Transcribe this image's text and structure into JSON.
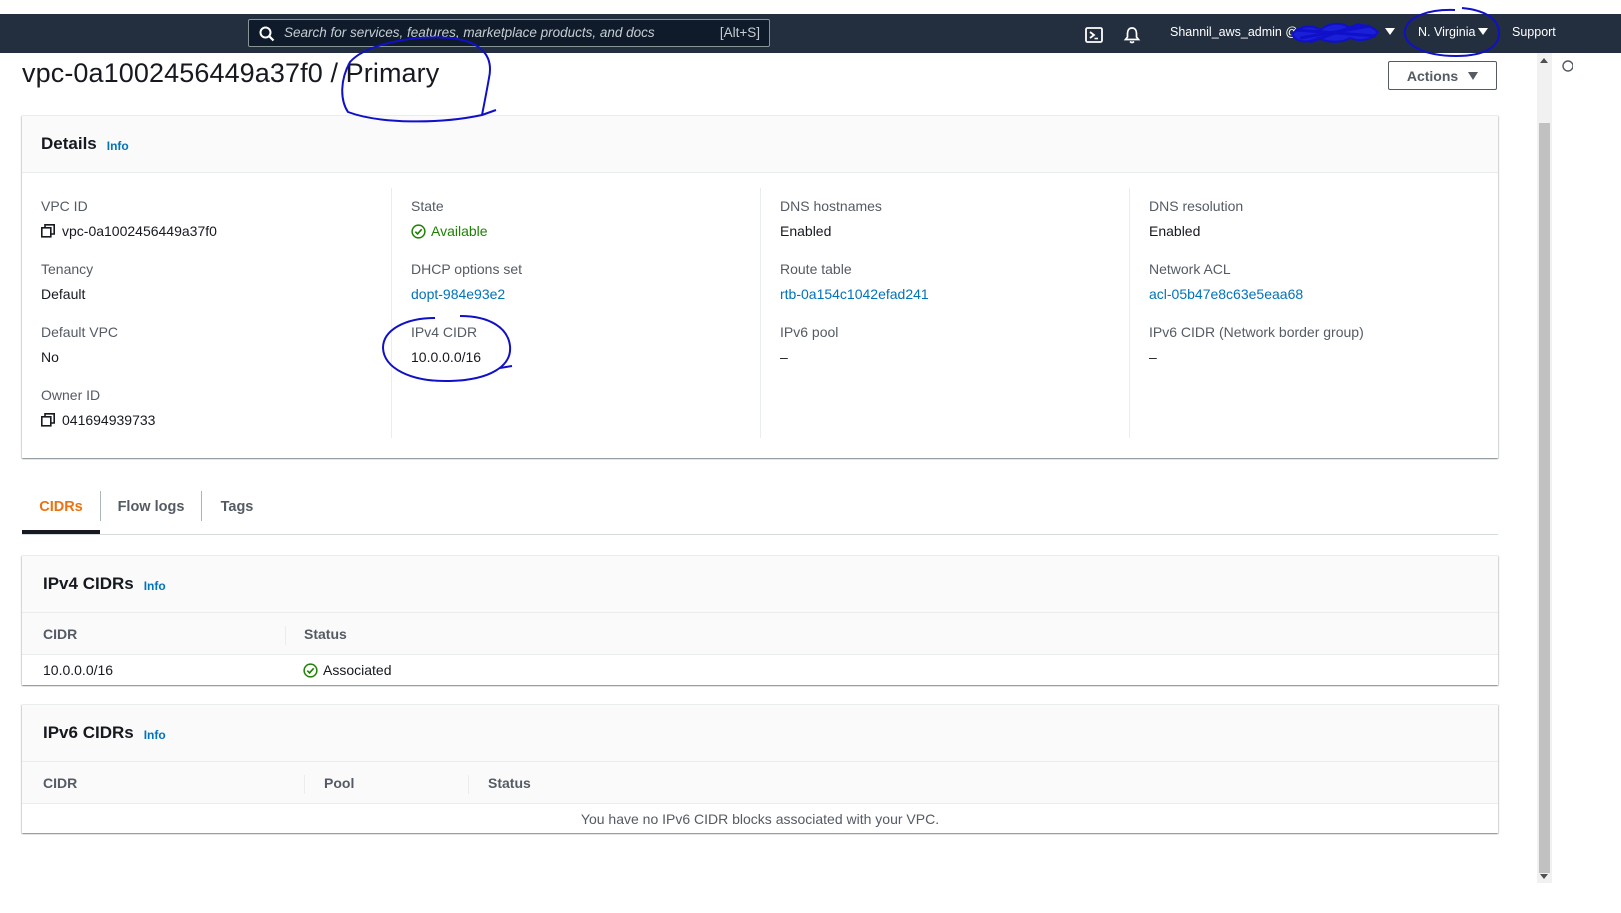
{
  "nav": {
    "search_placeholder": "Search for services, features, marketplace products, and docs",
    "search_shortcut": "[Alt+S]",
    "user_label": "Shannil_aws_admin @",
    "region": "N. Virginia",
    "support": "Support",
    "icons": [
      "search-icon",
      "cloudshell-icon",
      "bell-icon",
      "caret-down-icon"
    ]
  },
  "page": {
    "title": "vpc-0a1002456449a37f0 / Primary",
    "actions_label": "Actions"
  },
  "details": {
    "title": "Details",
    "info": "Info",
    "columns": [
      [
        {
          "label": "VPC ID",
          "value": "vpc-0a1002456449a37f0"
        },
        {
          "label": "Tenancy",
          "value": "Default"
        },
        {
          "label": "Default VPC",
          "value": "No"
        },
        {
          "label": "Owner ID",
          "value": "041694939733"
        }
      ],
      [
        {
          "label": "State",
          "value": "Available"
        },
        {
          "label": "DHCP options set",
          "value": "dopt-984e93e2"
        },
        {
          "label": "IPv4 CIDR",
          "value": "10.0.0.0/16"
        }
      ],
      [
        {
          "label": "DNS hostnames",
          "value": "Enabled"
        },
        {
          "label": "Route table",
          "value": "rtb-0a154c1042efad241"
        },
        {
          "label": "IPv6 pool",
          "value": "–"
        }
      ],
      [
        {
          "label": "DNS resolution",
          "value": "Enabled"
        },
        {
          "label": "Network ACL",
          "value": "acl-05b47e8c63e5eaa68"
        },
        {
          "label": "IPv6 CIDR (Network border group)",
          "value": "–"
        }
      ]
    ]
  },
  "tabs": [
    "CIDRs",
    "Flow logs",
    "Tags"
  ],
  "ipv4": {
    "title": "IPv4 CIDRs",
    "info": "Info",
    "headers": [
      "CIDR",
      "Status"
    ],
    "rows": [
      {
        "cidr": "10.0.0.0/16",
        "status": "Associated"
      }
    ]
  },
  "ipv6": {
    "title": "IPv6 CIDRs",
    "info": "Info",
    "headers": [
      "CIDR",
      "Pool",
      "Status"
    ],
    "empty_message": "You have no IPv6 CIDR blocks associated with your VPC."
  },
  "colors": {
    "nav_bg": "#232f3e",
    "link": "#0073bb",
    "success": "#1d8102",
    "active_tab": "#ec7211",
    "annotation_ink": "#1010c8"
  }
}
